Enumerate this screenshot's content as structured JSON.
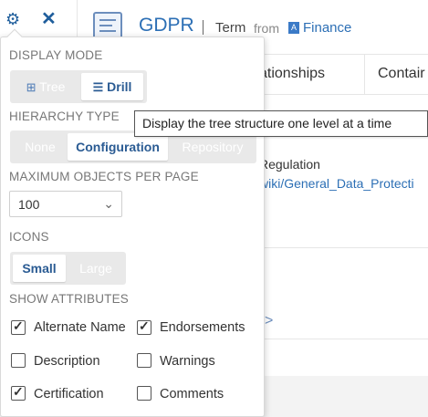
{
  "header": {
    "gear_icon": "gear-icon",
    "close_icon": "close-icon",
    "object_title": "GDPR",
    "object_type": "Term",
    "from_label": "from",
    "domain_badge": "A",
    "domain": "Finance"
  },
  "tabs": {
    "relationships": "ationships",
    "contains": "Contair"
  },
  "content": {
    "field_label": "Regulation",
    "field_link": "wiki/General_Data_Protecti"
  },
  "tooltip": "Display the tree structure one level at a time",
  "settings": {
    "display_mode": {
      "title": "DISPLAY MODE",
      "options": [
        "Tree",
        "Drill"
      ],
      "selected": "Drill"
    },
    "hierarchy_type": {
      "title": "HIERARCHY TYPE",
      "options": [
        "None",
        "Configuration",
        "Repository"
      ],
      "selected": "Configuration"
    },
    "max_objects": {
      "title": "MAXIMUM OBJECTS PER PAGE",
      "value": "100"
    },
    "icons": {
      "title": "ICONS",
      "options": [
        "Small",
        "Large"
      ],
      "selected": "Small"
    },
    "show_attributes": {
      "title": "SHOW ATTRIBUTES",
      "items": [
        {
          "label": "Alternate Name",
          "checked": true
        },
        {
          "label": "Endorsements",
          "checked": true
        },
        {
          "label": "Description",
          "checked": false
        },
        {
          "label": "Warnings",
          "checked": false
        },
        {
          "label": "Certification",
          "checked": true
        },
        {
          "label": "Comments",
          "checked": false
        }
      ]
    }
  },
  "colors": {
    "accent": "#2c6fb5",
    "active_text": "#2a5b93",
    "segment_bg": "#e9e9e9"
  }
}
